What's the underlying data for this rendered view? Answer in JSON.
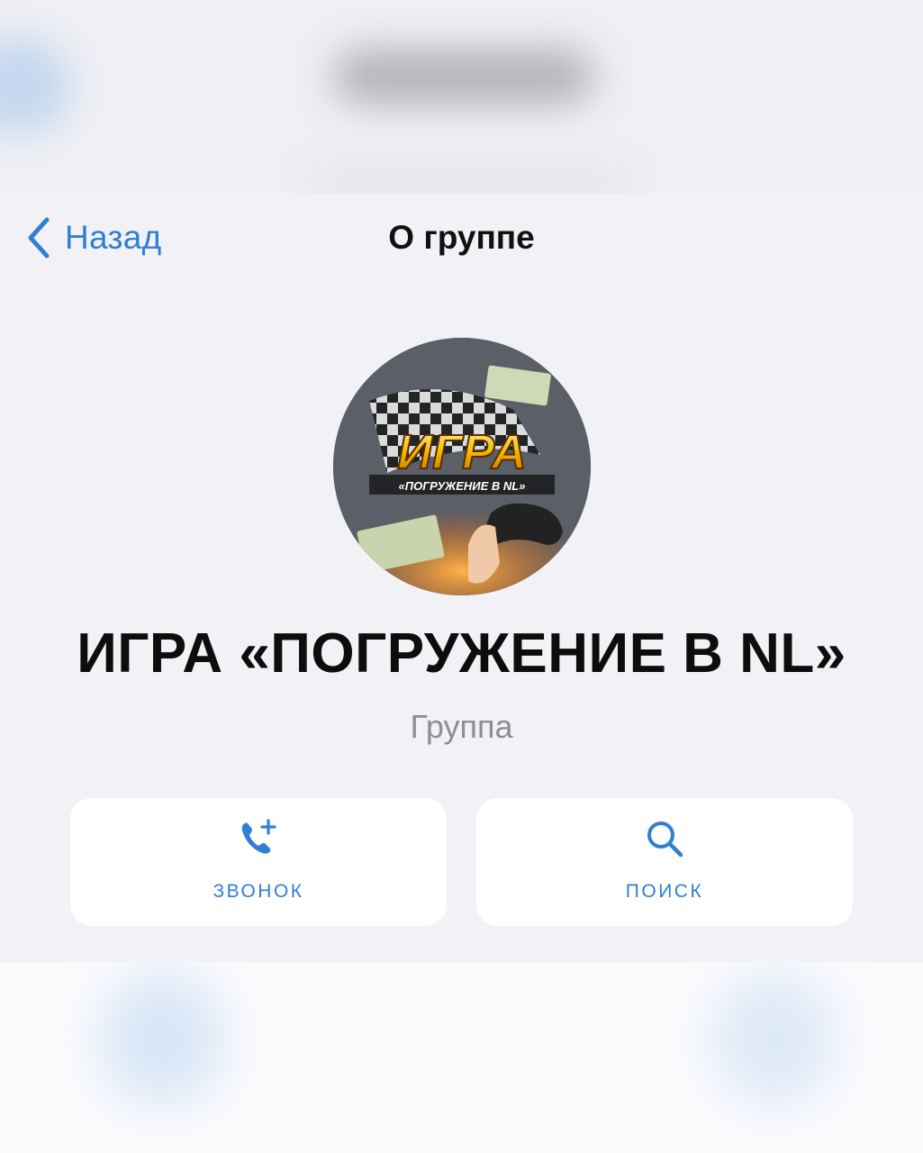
{
  "nav": {
    "back_label": "Назад",
    "title": "О группе"
  },
  "group": {
    "name": "ИГРА «ПОГРУЖЕНИЕ В NL»",
    "subtitle": "Группа",
    "avatar_title": "ИГРА",
    "avatar_subtitle": "«ПОГРУЖЕНИЕ В NL»"
  },
  "actions": {
    "call": {
      "label": "ЗВОНОК",
      "icon": "phone-plus-icon"
    },
    "search": {
      "label": "ПОИСК",
      "icon": "search-icon"
    }
  },
  "colors": {
    "accent": "#2f7fd3",
    "background": "#f2f2f6",
    "card": "#ffffff",
    "secondary_text": "#8e8e93"
  }
}
